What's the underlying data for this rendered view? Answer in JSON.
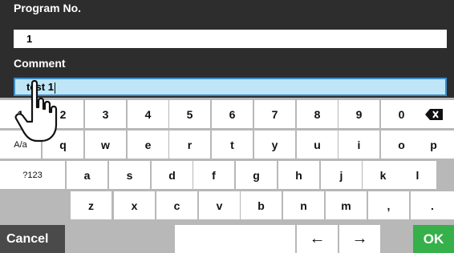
{
  "form": {
    "program_label": "Program No.",
    "program_value": "1",
    "comment_label": "Comment",
    "comment_value": "test 1"
  },
  "keyboard": {
    "row1": [
      "1",
      "2",
      "3",
      "4",
      "5",
      "6",
      "7",
      "8",
      "9",
      "0"
    ],
    "row2": [
      "q",
      "w",
      "e",
      "r",
      "t",
      "y",
      "u",
      "i",
      "o",
      "p"
    ],
    "row3": [
      "a",
      "s",
      "d",
      "f",
      "g",
      "h",
      "j",
      "k",
      "l"
    ],
    "row4": [
      "z",
      "x",
      "c",
      "v",
      "b",
      "n",
      "m",
      ",",
      "."
    ],
    "mode_label": "A/a",
    "symbols_label": "?123",
    "backspace_icon": "backspace-icon",
    "left_arrow": "←",
    "right_arrow": "→"
  },
  "actions": {
    "cancel_label": "Cancel",
    "ok_label": "OK"
  },
  "colors": {
    "header_bg": "#2d2d2d",
    "active_field": "#bfe6f7",
    "ok_bg": "#36b04a",
    "cancel_bg": "#4a4a4a"
  }
}
